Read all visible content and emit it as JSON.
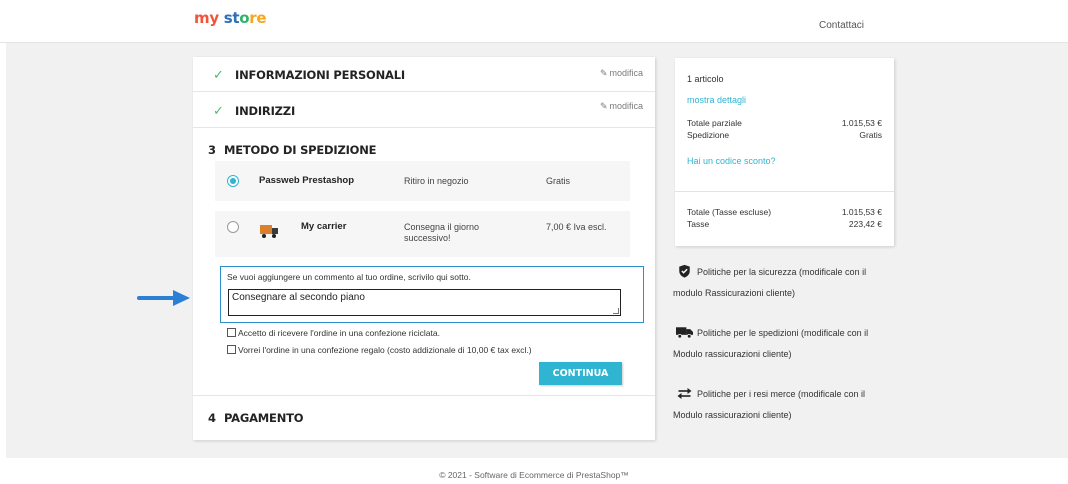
{
  "header": {
    "logo": {
      "part1": "my",
      "part2": "st",
      "part3": "o",
      "part4": "re"
    },
    "contact_label": "Contattaci"
  },
  "checkout": {
    "steps": [
      {
        "title": "INFORMAZIONI PERSONALI",
        "edit_label": "modifica",
        "status": "complete"
      },
      {
        "title": "INDIRIZZI",
        "edit_label": "modifica",
        "status": "complete"
      },
      {
        "number": "3",
        "title": "METODO DI SPEDIZIONE",
        "status": "current"
      },
      {
        "number": "4",
        "title": "PAGAMENTO",
        "status": "pending"
      }
    ],
    "carriers": [
      {
        "name": "Passweb Prestashop",
        "delay": "Ritiro in negozio",
        "price": "Gratis",
        "selected": true
      },
      {
        "name": "My carrier",
        "delay": "Consegna il giorno successivo!",
        "price": "7,00 € Iva escl.",
        "selected": false
      }
    ],
    "comment": {
      "label": "Se vuoi aggiungere un commento al tuo ordine, scrivilo qui sotto.",
      "value": "Consegnare al secondo piano"
    },
    "options": [
      {
        "label": "Accetto di ricevere l'ordine in una confezione riciclata.",
        "checked": false
      },
      {
        "label": "Vorrei l'ordine in una confezione regalo (costo addizionale di 10,00 € tax excl.)",
        "checked": false
      }
    ],
    "continue_label": "CONTINUA"
  },
  "summary": {
    "items_count": "1 articolo",
    "show_details": "mostra dettagli",
    "subtotal_label": "Totale parziale",
    "subtotal_value": "1.015,53 €",
    "shipping_label": "Spedizione",
    "shipping_value": "Gratis",
    "discount_link": "Hai un codice sconto?",
    "total_label": "Totale (Tasse escluse)",
    "total_value": "1.015,53 €",
    "taxes_label": "Tasse",
    "taxes_value": "223,42 €"
  },
  "reassurance": [
    {
      "icon": "shield-check-icon",
      "line1": "Politiche per la sicurezza (modificale con il",
      "line2": "modulo Rassicurazioni cliente)"
    },
    {
      "icon": "truck-icon",
      "line1": "Politiche per le spedizioni (modificale con il",
      "line2": "Modulo rassicurazioni cliente)"
    },
    {
      "icon": "swap-arrows-icon",
      "line1": "Politiche per i resi merce (modificale con il",
      "line2": "Modulo rassicurazioni cliente)"
    }
  ],
  "footer": {
    "text": "© 2021 - Software di Ecommerce di PrestaShop™"
  },
  "colors": {
    "accent": "#2fb5d2",
    "check": "#4cbb6c",
    "annotation_arrow": "#2b7fd4"
  }
}
